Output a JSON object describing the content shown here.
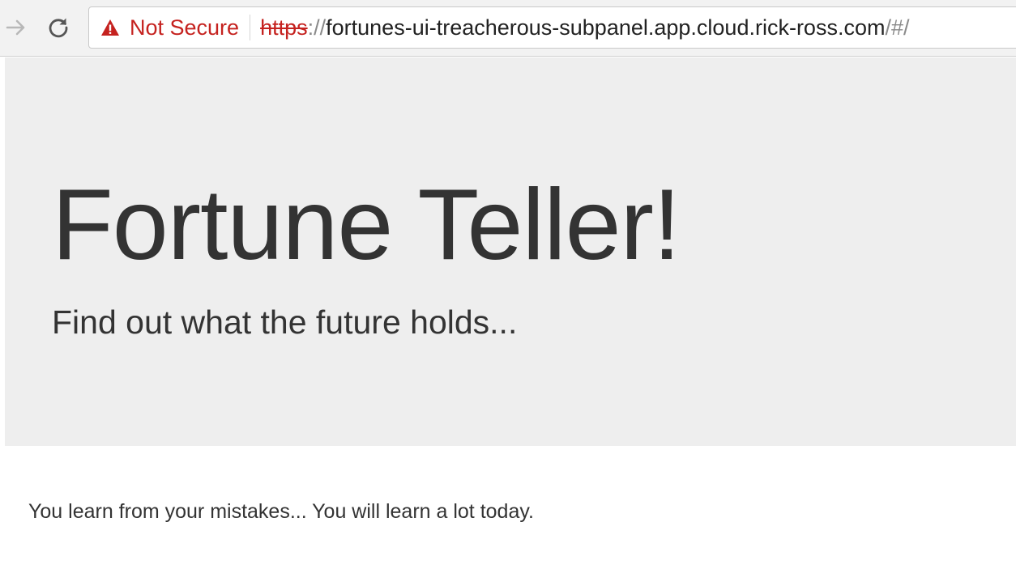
{
  "browser": {
    "security_label": "Not Secure",
    "url": {
      "scheme": "https",
      "separator": "://",
      "host": "fortunes-ui-treacherous-subpanel.app.cloud.rick-ross.com",
      "path": "/#/"
    },
    "icons": {
      "forward": "forward-arrow-icon",
      "reload": "reload-icon",
      "warning": "warning-triangle-icon"
    },
    "colors": {
      "not_secure": "#c5221f",
      "toolbar_bg": "#f2f2f2"
    }
  },
  "jumbotron": {
    "title": "Fortune Teller!",
    "subtitle": "Find out what the future holds...",
    "background": "#eeeeee"
  },
  "fortune": {
    "text": "You learn from your mistakes... You will learn a lot today."
  }
}
